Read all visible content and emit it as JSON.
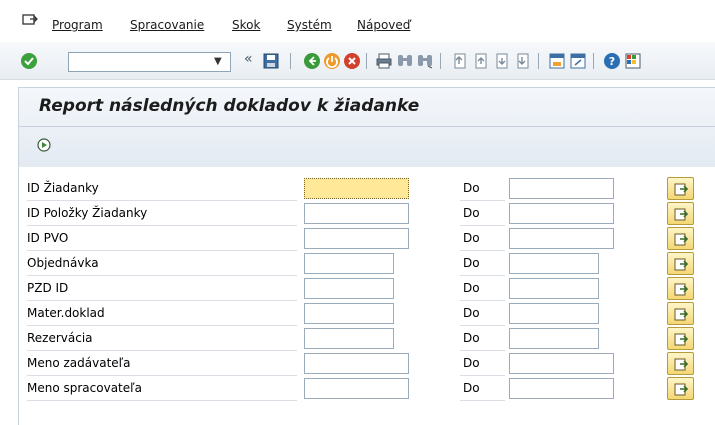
{
  "menu": {
    "items": [
      {
        "label": "Program"
      },
      {
        "label": "Spracovanie"
      },
      {
        "label": "Skok"
      },
      {
        "label": "Systém"
      },
      {
        "label": "Nápoveď"
      }
    ]
  },
  "toolbar": {
    "command_field_value": "",
    "icons": [
      "enter-check-icon",
      "back-double-arrow-icon",
      "save-icon",
      "back-icon",
      "exit-icon",
      "cancel-icon",
      "print-icon",
      "find-icon",
      "find-next-icon",
      "first-page-icon",
      "previous-page-icon",
      "next-page-icon",
      "last-page-icon",
      "create-session-icon",
      "shortcut-icon",
      "help-icon",
      "layout-icon"
    ]
  },
  "screen": {
    "title": "Report následných dokladov k žiadanke"
  },
  "form": {
    "to_label": "Do",
    "rows": [
      {
        "label": "ID Žiadanky"
      },
      {
        "label": "ID Položky Žiadanky"
      },
      {
        "label": "ID PVO"
      },
      {
        "label": "Objednávka"
      },
      {
        "label": "PZD ID"
      },
      {
        "label": "Mater.doklad"
      },
      {
        "label": "Rezervácia"
      },
      {
        "label": "Meno zadávateľa"
      },
      {
        "label": "Meno spracovateľa"
      }
    ]
  },
  "colors": {
    "focus_field": "#ffe898",
    "multi_button": "#f4d773",
    "panel": "#e3eaf2"
  }
}
